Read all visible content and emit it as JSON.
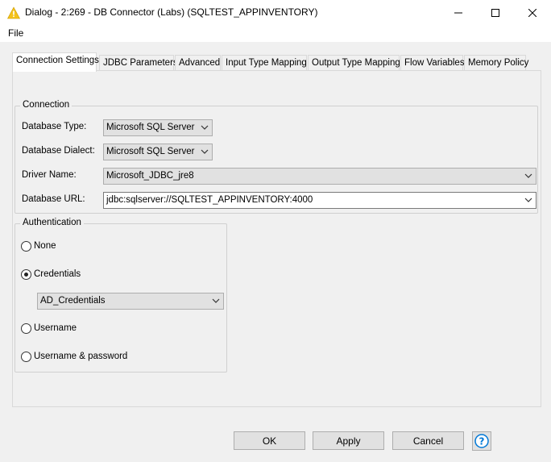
{
  "window": {
    "title": "Dialog - 2:269 - DB Connector (Labs) (SQLTEST_APPINVENTORY)",
    "icon": "knime-warning-triangle-icon"
  },
  "menu": {
    "file": "File"
  },
  "tabs": [
    {
      "label": "Connection Settings",
      "active": true
    },
    {
      "label": "JDBC Parameters"
    },
    {
      "label": "Advanced"
    },
    {
      "label": "Input Type Mapping"
    },
    {
      "label": "Output Type Mapping"
    },
    {
      "label": "Flow Variables"
    },
    {
      "label": "Memory Policy"
    }
  ],
  "connection": {
    "legend": "Connection",
    "database_type_label": "Database Type:",
    "database_type_value": "Microsoft SQL Server",
    "database_dialect_label": "Database Dialect:",
    "database_dialect_value": "Microsoft SQL Server",
    "driver_name_label": "Driver Name:",
    "driver_name_value": "Microsoft_JDBC_jre8",
    "database_url_label": "Database URL:",
    "database_url_value": "jdbc:sqlserver://SQLTEST_APPINVENTORY:4000"
  },
  "authentication": {
    "legend": "Authentication",
    "options": [
      {
        "label": "None",
        "checked": false
      },
      {
        "label": "Credentials",
        "checked": true
      },
      {
        "label": "Username",
        "checked": false
      },
      {
        "label": "Username & password",
        "checked": false
      }
    ],
    "credentials_value": "AD_Credentials"
  },
  "buttons": {
    "ok": "OK",
    "apply": "Apply",
    "cancel": "Cancel",
    "help_icon": "help-question-icon"
  },
  "colors": {
    "accent": "#0078d7",
    "warning_yellow": "#f4c21a"
  }
}
